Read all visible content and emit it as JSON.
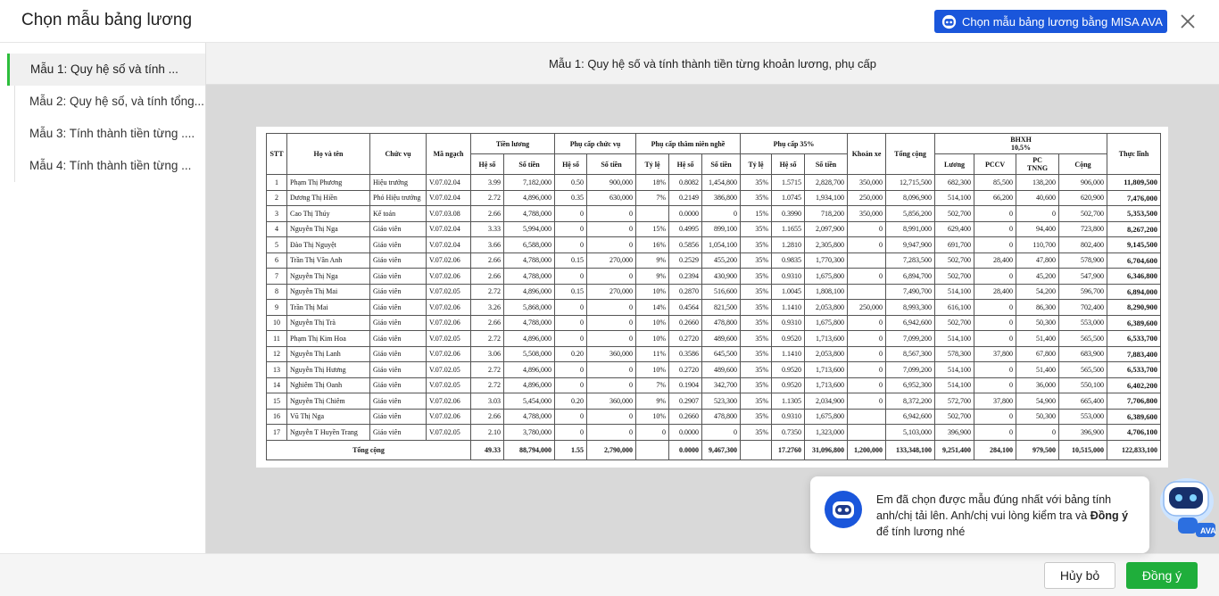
{
  "dialog": {
    "title": "Chọn mẫu bảng lương",
    "ava_button_label": "Chọn mẫu bảng lương bằng MISA AVA",
    "close_icon": "close-icon"
  },
  "sidebar": {
    "items": [
      {
        "label": "Mẫu 1: Quy hệ số và tính ...",
        "active": true
      },
      {
        "label": "Mẫu 2: Quy hệ số, và tính tổng...",
        "active": false
      },
      {
        "label": "Mẫu 3: Tính thành tiền từng ....",
        "active": false
      },
      {
        "label": "Mẫu 4: Tính thành tiền từng ...",
        "active": false
      }
    ]
  },
  "preview": {
    "heading": "Mẫu 1: Quy hệ số và tính thành tiền từng khoản lương, phụ cấp",
    "table": {
      "headers": {
        "stt": "STT",
        "name": "Họ và tên",
        "position": "Chức vụ",
        "code": "Mã ngạch",
        "salary": "Tiền lương",
        "position_allowance": "Phụ cấp chức vụ",
        "seniority_allowance": "Phụ cấp thâm niên nghề",
        "allowance35": "Phụ cấp 35%",
        "transport": "Khoán xe",
        "total": "Tổng cộng",
        "insurance": "BHXH",
        "insurance_rate": "10,5%",
        "net": "Thực lĩnh",
        "coef": "Hệ số",
        "amount": "Số tiền",
        "rate": "Tỷ lệ",
        "ins_salary": "Lương",
        "ins_pccv": "PCCV",
        "ins_pc": "PC",
        "ins_tnng": "TNNG",
        "ins_sum": "Cộng"
      },
      "rows": [
        [
          "1",
          "Phạm Thị Phương",
          "Hiệu trưởng",
          "V.07.02.04",
          "3.99",
          "7,182,000",
          "0.50",
          "900,000",
          "18%",
          "0.8082",
          "1,454,800",
          "35%",
          "1.5715",
          "2,828,700",
          "350,000",
          "12,715,500",
          "682,300",
          "85,500",
          "138,200",
          "906,000",
          "11,809,500"
        ],
        [
          "2",
          "Dương Thị Hiền",
          "Phó Hiệu trưởng",
          "V.07.02.04",
          "2.72",
          "4,896,000",
          "0.35",
          "630,000",
          "7%",
          "0.2149",
          "386,800",
          "35%",
          "1.0745",
          "1,934,100",
          "250,000",
          "8,096,900",
          "514,100",
          "66,200",
          "40,600",
          "620,900",
          "7,476,000"
        ],
        [
          "3",
          "Cao Thị Thúy",
          "Kế toán",
          "V.07.03.08",
          "2.66",
          "4,788,000",
          "0",
          "0",
          "",
          "0.0000",
          "0",
          "15%",
          "0.3990",
          "718,200",
          "350,000",
          "5,856,200",
          "502,700",
          "0",
          "0",
          "502,700",
          "5,353,500"
        ],
        [
          "4",
          "Nguyễn Thị Nga",
          "Giáo viên",
          "V.07.02.04",
          "3.33",
          "5,994,000",
          "0",
          "0",
          "15%",
          "0.4995",
          "899,100",
          "35%",
          "1.1655",
          "2,097,900",
          "0",
          "8,991,000",
          "629,400",
          "0",
          "94,400",
          "723,800",
          "8,267,200"
        ],
        [
          "5",
          "Đào Thị Nguyệt",
          "Giáo viên",
          "V.07.02.04",
          "3.66",
          "6,588,000",
          "0",
          "0",
          "16%",
          "0.5856",
          "1,054,100",
          "35%",
          "1.2810",
          "2,305,800",
          "0",
          "9,947,900",
          "691,700",
          "0",
          "110,700",
          "802,400",
          "9,145,500"
        ],
        [
          "6",
          "Trần Thị Vân Anh",
          "Giáo viên",
          "V.07.02.06",
          "2.66",
          "4,788,000",
          "0.15",
          "270,000",
          "9%",
          "0.2529",
          "455,200",
          "35%",
          "0.9835",
          "1,770,300",
          "",
          "7,283,500",
          "502,700",
          "28,400",
          "47,800",
          "578,900",
          "6,704,600"
        ],
        [
          "7",
          "Nguyễn Thị Nga",
          "Giáo viên",
          "V.07.02.06",
          "2.66",
          "4,788,000",
          "0",
          "0",
          "9%",
          "0.2394",
          "430,900",
          "35%",
          "0.9310",
          "1,675,800",
          "0",
          "6,894,700",
          "502,700",
          "0",
          "45,200",
          "547,900",
          "6,346,800"
        ],
        [
          "8",
          "Nguyễn Thị Mai",
          "Giáo viên",
          "V.07.02.05",
          "2.72",
          "4,896,000",
          "0.15",
          "270,000",
          "10%",
          "0.2870",
          "516,600",
          "35%",
          "1.0045",
          "1,808,100",
          "",
          "7,490,700",
          "514,100",
          "28,400",
          "54,200",
          "596,700",
          "6,894,000"
        ],
        [
          "9",
          "Trần Thị Mai",
          "Giáo viên",
          "V.07.02.06",
          "3.26",
          "5,868,000",
          "0",
          "0",
          "14%",
          "0.4564",
          "821,500",
          "35%",
          "1.1410",
          "2,053,800",
          "250,000",
          "8,993,300",
          "616,100",
          "0",
          "86,300",
          "702,400",
          "8,290,900"
        ],
        [
          "10",
          "Nguyễn Thị Trà",
          "Giáo viên",
          "V.07.02.06",
          "2.66",
          "4,788,000",
          "0",
          "0",
          "10%",
          "0.2660",
          "478,800",
          "35%",
          "0.9310",
          "1,675,800",
          "0",
          "6,942,600",
          "502,700",
          "0",
          "50,300",
          "553,000",
          "6,389,600"
        ],
        [
          "11",
          "Phạm Thị Kim Hoa",
          "Giáo viên",
          "V.07.02.05",
          "2.72",
          "4,896,000",
          "0",
          "0",
          "10%",
          "0.2720",
          "489,600",
          "35%",
          "0.9520",
          "1,713,600",
          "0",
          "7,099,200",
          "514,100",
          "0",
          "51,400",
          "565,500",
          "6,533,700"
        ],
        [
          "12",
          "Nguyễn Thị Lanh",
          "Giáo viên",
          "V.07.02.06",
          "3.06",
          "5,508,000",
          "0.20",
          "360,000",
          "11%",
          "0.3586",
          "645,500",
          "35%",
          "1.1410",
          "2,053,800",
          "0",
          "8,567,300",
          "578,300",
          "37,800",
          "67,800",
          "683,900",
          "7,883,400"
        ],
        [
          "13",
          "Nguyễn Thị Hương",
          "Giáo viên",
          "V.07.02.05",
          "2.72",
          "4,896,000",
          "0",
          "0",
          "10%",
          "0.2720",
          "489,600",
          "35%",
          "0.9520",
          "1,713,600",
          "0",
          "7,099,200",
          "514,100",
          "0",
          "51,400",
          "565,500",
          "6,533,700"
        ],
        [
          "14",
          "Nghiêm Thị Oanh",
          "Giáo viên",
          "V.07.02.05",
          "2.72",
          "4,896,000",
          "0",
          "0",
          "7%",
          "0.1904",
          "342,700",
          "35%",
          "0.9520",
          "1,713,600",
          "0",
          "6,952,300",
          "514,100",
          "0",
          "36,000",
          "550,100",
          "6,402,200"
        ],
        [
          "15",
          "Nguyễn Thị Chiêm",
          "Giáo viên",
          "V.07.02.06",
          "3.03",
          "5,454,000",
          "0.20",
          "360,000",
          "9%",
          "0.2907",
          "523,300",
          "35%",
          "1.1305",
          "2,034,900",
          "0",
          "8,372,200",
          "572,700",
          "37,800",
          "54,900",
          "665,400",
          "7,706,800"
        ],
        [
          "16",
          "Vũ Thị Nga",
          "Giáo viên",
          "V.07.02.06",
          "2.66",
          "4,788,000",
          "0",
          "0",
          "10%",
          "0.2660",
          "478,800",
          "35%",
          "0.9310",
          "1,675,800",
          "",
          "6,942,600",
          "502,700",
          "0",
          "50,300",
          "553,000",
          "6,389,600"
        ],
        [
          "17",
          "Nguyễn T Huyền Trang",
          "Giáo viên",
          "V.07.02.05",
          "2.10",
          "3,780,000",
          "0",
          "0",
          "0",
          "0.0000",
          "0",
          "35%",
          "0.7350",
          "1,323,000",
          "",
          "5,103,000",
          "396,900",
          "0",
          "0",
          "396,900",
          "4,706,100"
        ]
      ],
      "total": {
        "label": "Tổng cộng",
        "values": [
          "49.33",
          "88,794,000",
          "1.55",
          "2,790,000",
          "",
          "0.0000",
          "9,467,300",
          "",
          "17.2760",
          "31,096,800",
          "1,200,000",
          "133,348,100",
          "9,251,400",
          "284,100",
          "979,500",
          "10,515,000",
          "122,833,100"
        ]
      }
    }
  },
  "assistant": {
    "message_part1": "Em đã chọn được mẫu đúng nhất với bảng tính anh/chị tải lên. Anh/chị vui lòng kiểm tra và ",
    "message_bold": "Đồng ý",
    "message_part2": " để tính lương nhé",
    "avatar_icon": "ava-robot-icon"
  },
  "footer": {
    "cancel_label": "Hủy bỏ",
    "ok_label": "Đồng ý"
  },
  "colors": {
    "primary_blue": "#1a56db",
    "accent_green": "#1fae3b",
    "active_indicator": "#2dbe3c"
  }
}
